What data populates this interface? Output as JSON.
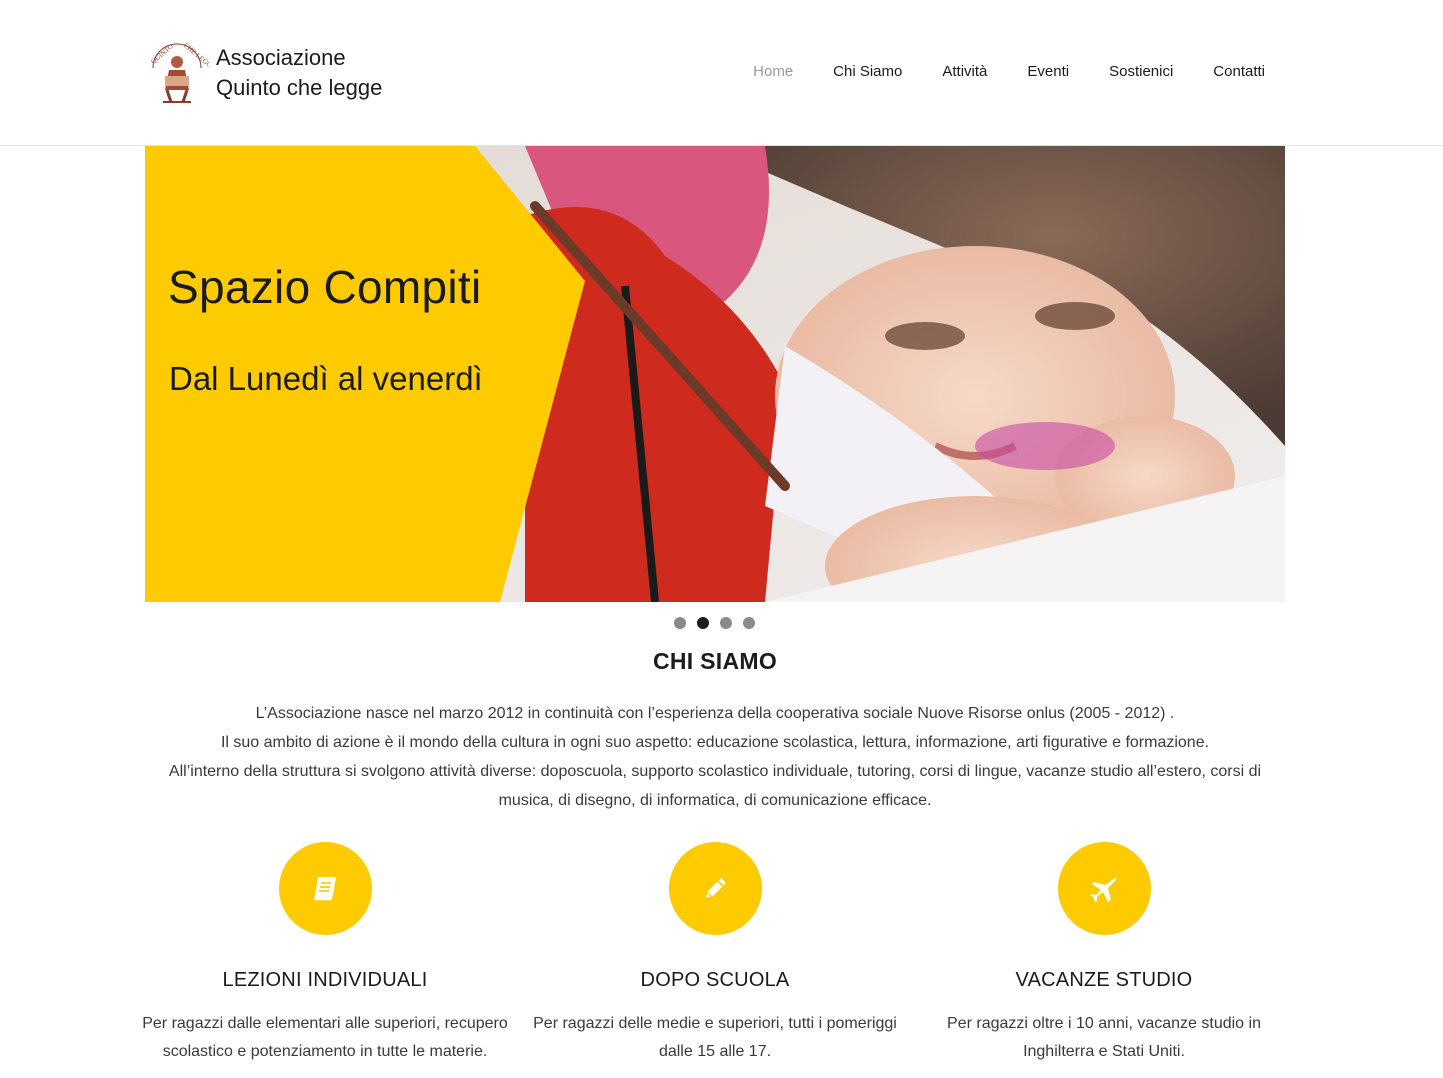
{
  "header": {
    "brand_line1": "Associazione",
    "brand_line2": "Quinto che legge",
    "nav": [
      {
        "label": "Home",
        "active": true
      },
      {
        "label": "Chi Siamo"
      },
      {
        "label": "Attività"
      },
      {
        "label": "Eventi"
      },
      {
        "label": "Sostienici"
      },
      {
        "label": "Contatti"
      }
    ]
  },
  "slider": {
    "title": "Spazio Compiti",
    "subtitle": "Dal Lunedì al venerdì",
    "accent_color": "#fecb00",
    "slides_count": 4,
    "active_slide": 2
  },
  "about": {
    "title": "CHI SIAMO",
    "paragraphs": [
      "L’Associazione nasce nel marzo 2012 in continuità con l’esperienza della cooperativa sociale Nuove Risorse onlus (2005 - 2012) .",
      "Il suo ambito di azione è il mondo della cultura in ogni suo aspetto: educazione scolastica, lettura, informazione, arti figurative e formazione.",
      "All’interno della struttura si svolgono attività diverse: doposcuola, supporto scolastico individuale, tutoring, corsi di lingue, vacanze studio all’estero, corsi di musica, di disegno, di informatica, di comunicazione efficace."
    ]
  },
  "features": [
    {
      "icon": "book-icon",
      "title": "LEZIONI INDIVIDUALI",
      "text": "Per ragazzi dalle elementari alle superiori, recupero scolastico e potenziamento in tutte le materie."
    },
    {
      "icon": "pencil-icon",
      "title": "DOPO SCUOLA",
      "text": "Per ragazzi delle medie e superiori, tutti i pomeriggi dalle 15 alle 17."
    },
    {
      "icon": "plane-icon",
      "title": "VACANZE STUDIO",
      "text": "Per ragazzi oltre i 10 anni, vacanze studio in Inghilterra e Stati Uniti."
    }
  ],
  "colors": {
    "accent": "#fecb00",
    "nav_active": "#9a9a9a"
  }
}
